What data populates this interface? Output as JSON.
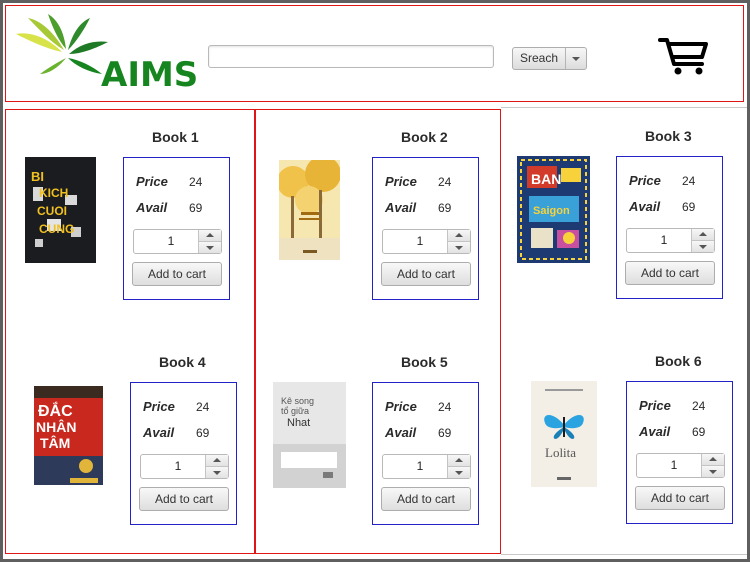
{
  "app": {
    "logo_text": "AIMS",
    "search": {
      "value": "",
      "placeholder": ""
    },
    "search_mode": {
      "selected": "Sreach"
    },
    "icons": {
      "logo": "leaf-logo-icon",
      "cart": "shopping-cart-icon",
      "dropdown": "chevron-down-icon"
    },
    "colors": {
      "brand_green": "#17851f",
      "column_border": "#e01515",
      "info_border": "#2222c8"
    }
  },
  "labels": {
    "price": "Price",
    "avail": "Avail",
    "add_to_cart": "Add to cart"
  },
  "books": [
    {
      "title": "Book 1",
      "price": "24",
      "avail": "69",
      "quantity": "1",
      "cover": {
        "title_text": "BI KICH CUOI CUNG",
        "bg": "#202124",
        "fg": "#f0c020"
      }
    },
    {
      "title": "Book 2",
      "price": "24",
      "avail": "69",
      "quantity": "1",
      "cover": {
        "title_text": "",
        "bg": "#f3d37a",
        "fg": "#a26b12"
      }
    },
    {
      "title": "Book 3",
      "price": "24",
      "avail": "69",
      "quantity": "1",
      "cover": {
        "title_text": "BAN SAI GON",
        "bg": "#1d3a73",
        "fg": "#f7d23a"
      }
    },
    {
      "title": "Book 4",
      "price": "24",
      "avail": "69",
      "quantity": "1",
      "cover": {
        "title_text": "ĐẮC NHÂN TÂM",
        "bg": "#c8281e",
        "fg": "#ffffff"
      }
    },
    {
      "title": "Book 5",
      "price": "24",
      "avail": "69",
      "quantity": "1",
      "cover": {
        "title_text": "Nhat",
        "bg": "#e7e7e7",
        "fg": "#444444"
      }
    },
    {
      "title": "Book 6",
      "price": "24",
      "avail": "69",
      "quantity": "1",
      "cover": {
        "title_text": "Lolita",
        "bg": "#f4efe6",
        "fg": "#555555"
      }
    }
  ]
}
